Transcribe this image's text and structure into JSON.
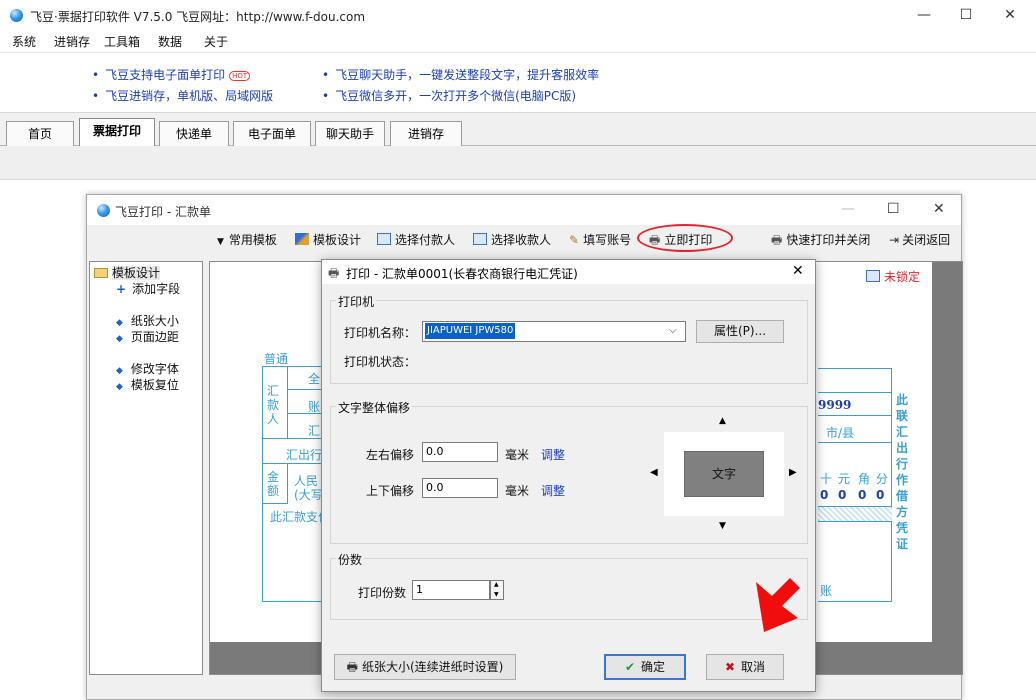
{
  "app": {
    "title": "飞豆·票据打印软件 V7.5.0   飞豆网址：http://www.f-dou.com",
    "window_buttons": {
      "minimize": "—",
      "maximize": "☐",
      "close": "✕"
    }
  },
  "menu": [
    "系统",
    "进销存",
    "工具箱",
    "数据",
    "关于"
  ],
  "news": {
    "left": [
      "飞豆支持电子面单打印",
      "飞豆进销存，单机版、局域网版"
    ],
    "hot": "HOT",
    "right": [
      "飞豆聊天助手，一键发送整段文字，提升客服效率",
      "飞豆微信多开，一次打开多个微信(电脑PC版)"
    ]
  },
  "tabs": [
    "首页",
    "票据打印",
    "快递单",
    "电子面单",
    "聊天助手",
    "进销存"
  ],
  "hk_window": {
    "title": "飞豆打印 - 汇款单",
    "toolbar": [
      "常用模板",
      "模板设计",
      "选择付款人",
      "选择收款人",
      "填写账号",
      "立即打印",
      "快速打印并关闭",
      "关闭返回"
    ],
    "tree": {
      "root": "模板设计",
      "items": [
        "添加字段",
        "纸张大小",
        "页面边距",
        "修改字体",
        "模板复位"
      ]
    },
    "lock_status": "未锁定",
    "doc_fragments": {
      "putong": "普通",
      "quan": "全",
      "zhang": "账",
      "hui_small": "汇",
      "payer": "汇款人",
      "payplace": "汇出行",
      "amount": "金额",
      "rmb": "人民",
      "daxie": "(大写",
      "note": "此汇款支付",
      "acct_tail": "9999",
      "city": "市/县",
      "digits_head": [
        "十",
        "元",
        "角",
        "分"
      ],
      "digits": [
        "0",
        "0",
        "0",
        "0"
      ],
      "side_text": "此联汇出行作借方凭证",
      "acct_word": "账"
    }
  },
  "dialog": {
    "title": "打印 - 汇款单0001(长春农商银行电汇凭证)",
    "printer_group": "打印机",
    "printer_name_label": "打印机名称：",
    "printer_name": "JIAPUWEI JPW580",
    "properties_button": "属性(P)...",
    "printer_status_label": "打印机状态：",
    "offset_group": "文字整体偏移",
    "lr_label": "左右偏移",
    "lr_value": "0.0",
    "ud_label": "上下偏移",
    "ud_value": "0.0",
    "unit": "毫米",
    "adjust": "调整",
    "preview_text": "文字",
    "copies_group": "份数",
    "copies_label": "打印份数",
    "copies_value": "1",
    "paper_size_button": "纸张大小(连续进纸时设置)",
    "ok_button": "确定",
    "cancel_button": "取消"
  },
  "colors": {
    "link_blue": "#1a3fb8",
    "form_blue": "#3aa0d0",
    "highlight_red": "#e8232b",
    "selection_blue": "#0a62c8"
  }
}
